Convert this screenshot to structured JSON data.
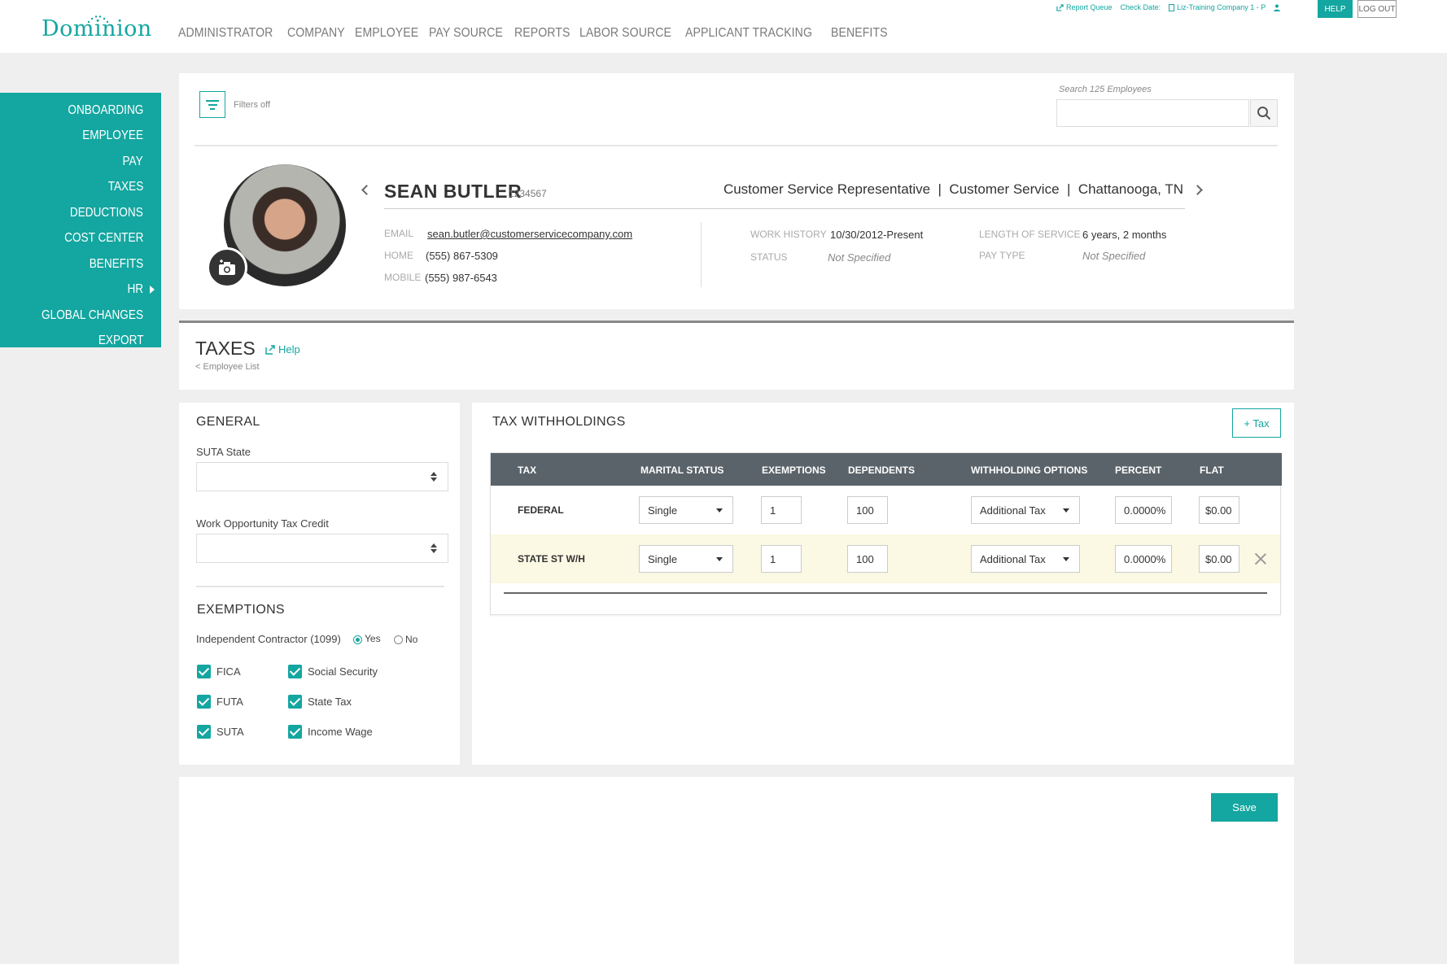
{
  "brand": {
    "name": "Dominion",
    "accent": "#14a6a0"
  },
  "mainnav": [
    "ADMINISTRATOR",
    "COMPANY",
    "EMPLOYEE",
    "PAY SOURCE",
    "REPORTS",
    "LABOR SOURCE",
    "APPLICANT TRACKING",
    "BENEFITS"
  ],
  "utils": {
    "report_queue": "Report Queue",
    "check_date": "Check Date:",
    "company": "Liz-Training Company 1 - P"
  },
  "header_buttons": {
    "help": "HELP",
    "logout": "LOG OUT"
  },
  "sidenav": [
    {
      "label": "ONBOARDING"
    },
    {
      "label": "EMPLOYEE"
    },
    {
      "label": "PAY"
    },
    {
      "label": "TAXES"
    },
    {
      "label": "DEDUCTIONS"
    },
    {
      "label": "COST CENTER"
    },
    {
      "label": "BENEFITS"
    },
    {
      "label": "HR"
    },
    {
      "label": "GLOBAL CHANGES"
    },
    {
      "label": "EXPORT"
    }
  ],
  "filters": {
    "label": "Filters off"
  },
  "search": {
    "label": "Search 125 Employees",
    "placeholder": ""
  },
  "employee": {
    "name": "SEAN BUTLER",
    "id": "1234567",
    "role_line": "Customer Service Representative  |  Customer Service  |  Chattanooga, TN",
    "email_label": "EMAIL",
    "email": "sean.butler@customerservicecompany.com",
    "home_label": "HOME",
    "home": "(555) 867-5309",
    "mobile_label": "MOBILE",
    "mobile": "(555) 987-6543",
    "work_history_label": "WORK HISTORY",
    "work_history": "10/30/2012-Present",
    "status_label": "STATUS",
    "status": "Not Specified",
    "los_label": "LENGTH OF SERVICE",
    "los": "6 years, 2 months",
    "pay_type_label": "PAY TYPE",
    "pay_type": "Not Specified"
  },
  "taxes": {
    "title": "TAXES",
    "help": "Help",
    "breadcrumb": "< Employee List"
  },
  "general": {
    "title": "GENERAL",
    "suta_label": "SUTA State",
    "wotc_label": "Work Opportunity Tax Credit"
  },
  "exemptions": {
    "title": "EXEMPTIONS",
    "contractor_label": "Independent Contractor (1099)",
    "yes": "Yes",
    "no": "No",
    "checks": [
      "FICA",
      "Social Security",
      "FUTA",
      "State Tax",
      "SUTA",
      "Income Wage"
    ]
  },
  "withholdings": {
    "title": "TAX WITHHOLDINGS",
    "add_button": "+ Tax",
    "columns": [
      "TAX",
      "MARITAL STATUS",
      "EXEMPTIONS",
      "DEPENDENTS",
      "WITHHOLDING OPTIONS",
      "PERCENT",
      "FLAT"
    ],
    "rows": [
      {
        "tax": "FEDERAL",
        "marital": "Single",
        "exemptions": "1",
        "dependents": "100",
        "option": "Additional Tax",
        "percent": "0.0000%",
        "flat": "$0.00"
      },
      {
        "tax": "STATE ST W/H",
        "marital": "Single",
        "exemptions": "1",
        "dependents": "100",
        "option": "Additional Tax",
        "percent": "0.0000%",
        "flat": "$0.00"
      }
    ]
  },
  "save_button": "Save"
}
